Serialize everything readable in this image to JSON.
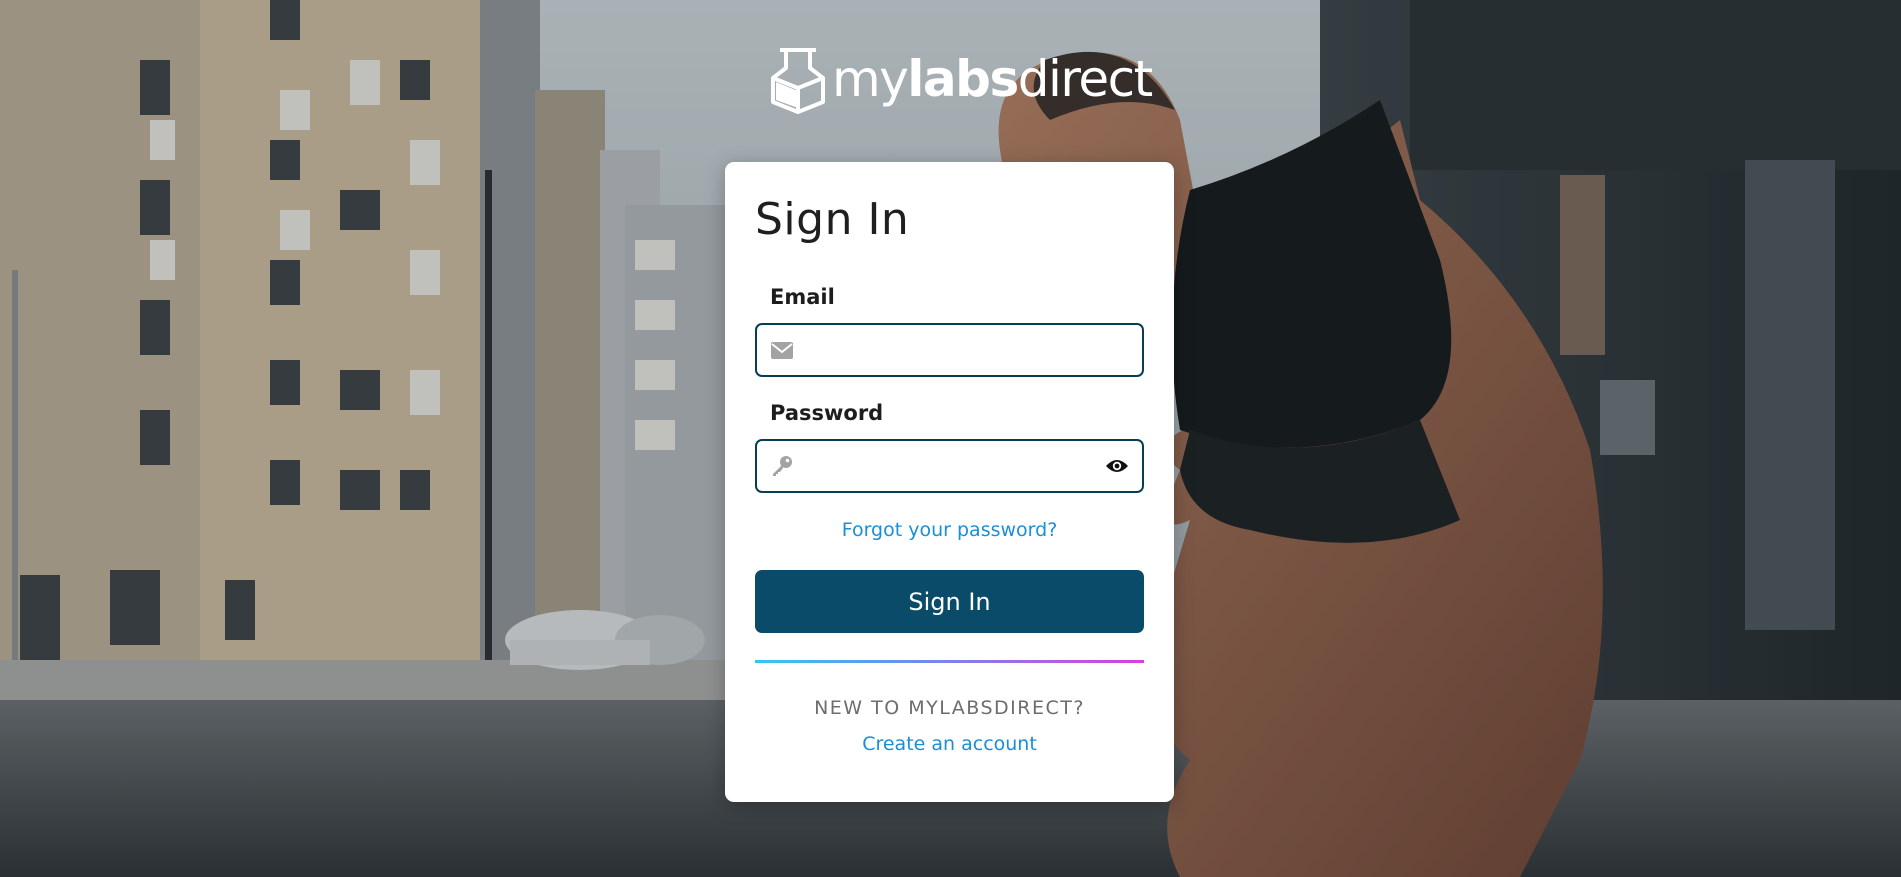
{
  "brand": {
    "name_part1": "my",
    "name_part2": "labs",
    "name_part3": "direct"
  },
  "signin": {
    "title": "Sign In",
    "email_label": "Email",
    "email_value": "",
    "email_placeholder": "",
    "password_label": "Password",
    "password_value": "",
    "password_placeholder": "",
    "forgot_link": "Forgot your password?",
    "submit_label": "Sign In",
    "new_prompt": "NEW TO MYLABSDIRECT?",
    "create_link": "Create an account"
  },
  "icons": {
    "email": "envelope-icon",
    "password": "key-icon",
    "toggle": "eye-icon"
  },
  "colors": {
    "primary": "#094b68",
    "link": "#1a8fd6",
    "field_border": "#083e55",
    "divider_start": "#33c7f2",
    "divider_end": "#d73fe0"
  }
}
